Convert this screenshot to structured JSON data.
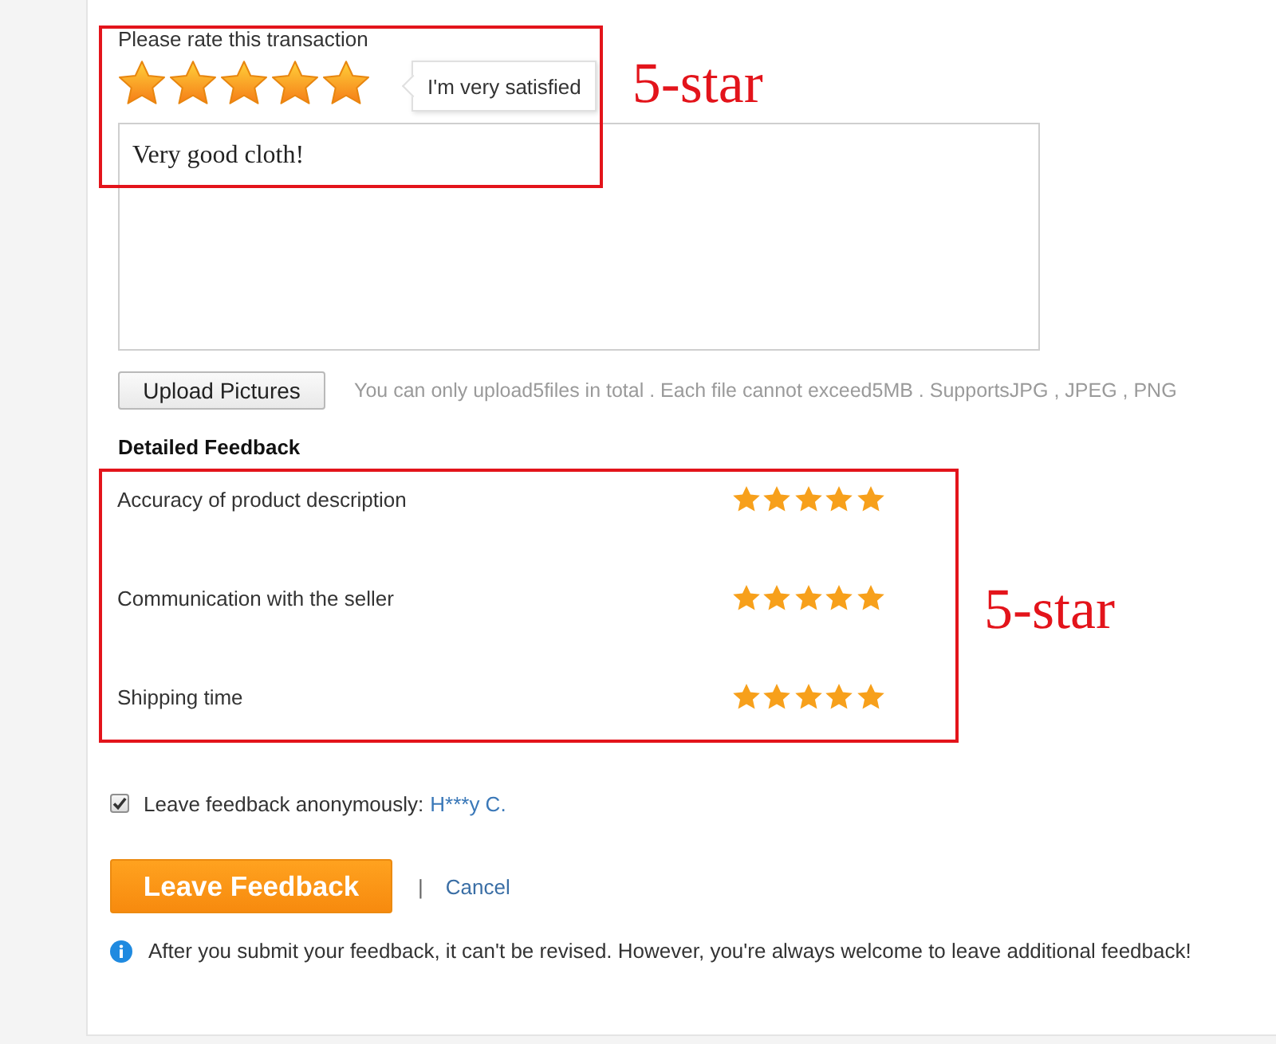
{
  "rating": {
    "label": "Please rate this transaction",
    "stars": 5,
    "tooltip": "I'm very satisfied",
    "annotation": "5-star"
  },
  "review": {
    "value": "Very good cloth!"
  },
  "upload": {
    "button": "Upload Pictures",
    "hint": "You can only upload5files in total . Each file cannot exceed5MB . SupportsJPG , JPEG , PNG"
  },
  "detailed_feedback": {
    "title": "Detailed Feedback",
    "annotation": "5-star",
    "items": [
      {
        "label": "Accuracy of product description",
        "stars": 5
      },
      {
        "label": "Communication with the seller",
        "stars": 5
      },
      {
        "label": "Shipping time",
        "stars": 5
      }
    ]
  },
  "anonymous": {
    "checked": true,
    "label": "Leave feedback anonymously:",
    "name": "H***y C."
  },
  "actions": {
    "submit": "Leave Feedback",
    "separator": "|",
    "cancel": "Cancel"
  },
  "notice": "After you submit your feedback, it can't be revised. However, you're always welcome to leave additional feedback!"
}
